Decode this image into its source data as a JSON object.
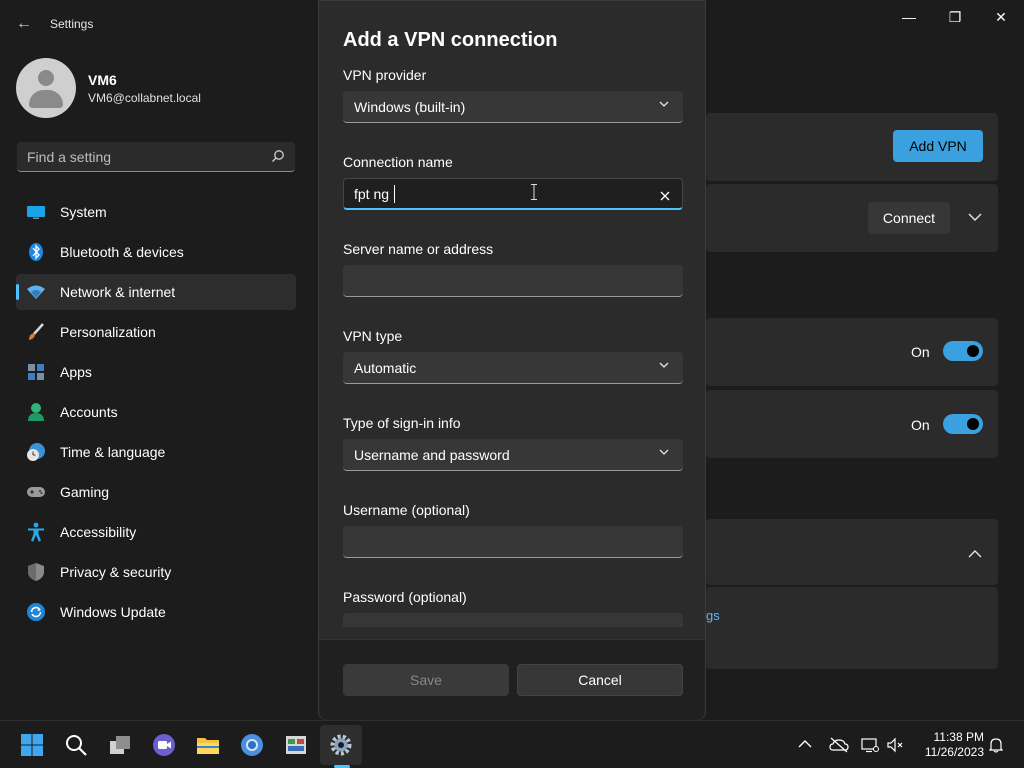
{
  "window": {
    "title": "Settings",
    "back": "←",
    "minimize": "—",
    "maximize": "❐",
    "close": "✕"
  },
  "profile": {
    "name": "VM6",
    "email": "VM6@collabnet.local"
  },
  "search": {
    "placeholder": "Find a setting"
  },
  "nav": [
    {
      "label": "System",
      "icon": "system-icon"
    },
    {
      "label": "Bluetooth & devices",
      "icon": "bluetooth-icon"
    },
    {
      "label": "Network & internet",
      "icon": "wifi-icon"
    },
    {
      "label": "Personalization",
      "icon": "brush-icon"
    },
    {
      "label": "Apps",
      "icon": "apps-icon"
    },
    {
      "label": "Accounts",
      "icon": "accounts-icon"
    },
    {
      "label": "Time & language",
      "icon": "time-language-icon"
    },
    {
      "label": "Gaming",
      "icon": "gamepad-icon"
    },
    {
      "label": "Accessibility",
      "icon": "accessibility-icon"
    },
    {
      "label": "Privacy & security",
      "icon": "shield-icon"
    },
    {
      "label": "Windows Update",
      "icon": "update-icon"
    }
  ],
  "background": {
    "add_vpn": "Add VPN",
    "connect": "Connect",
    "toggle1_label": "On",
    "toggle2_label": "On",
    "link_fragment": "gs"
  },
  "dialog": {
    "title": "Add a VPN connection",
    "provider_label": "VPN provider",
    "provider_value": "Windows (built-in)",
    "conn_name_label": "Connection name",
    "conn_name_value": "fpt ng",
    "server_label": "Server name or address",
    "server_value": "",
    "vpn_type_label": "VPN type",
    "vpn_type_value": "Automatic",
    "signin_label": "Type of sign-in info",
    "signin_value": "Username and password",
    "username_label": "Username (optional)",
    "username_value": "",
    "password_label": "Password (optional)",
    "save": "Save",
    "cancel": "Cancel"
  },
  "taskbar": {
    "time": "11:38 PM",
    "date": "11/26/2023"
  },
  "colors": {
    "accent": "#4cc2ff",
    "background": "#1c1c1c",
    "dialog": "#2b2b2b"
  }
}
